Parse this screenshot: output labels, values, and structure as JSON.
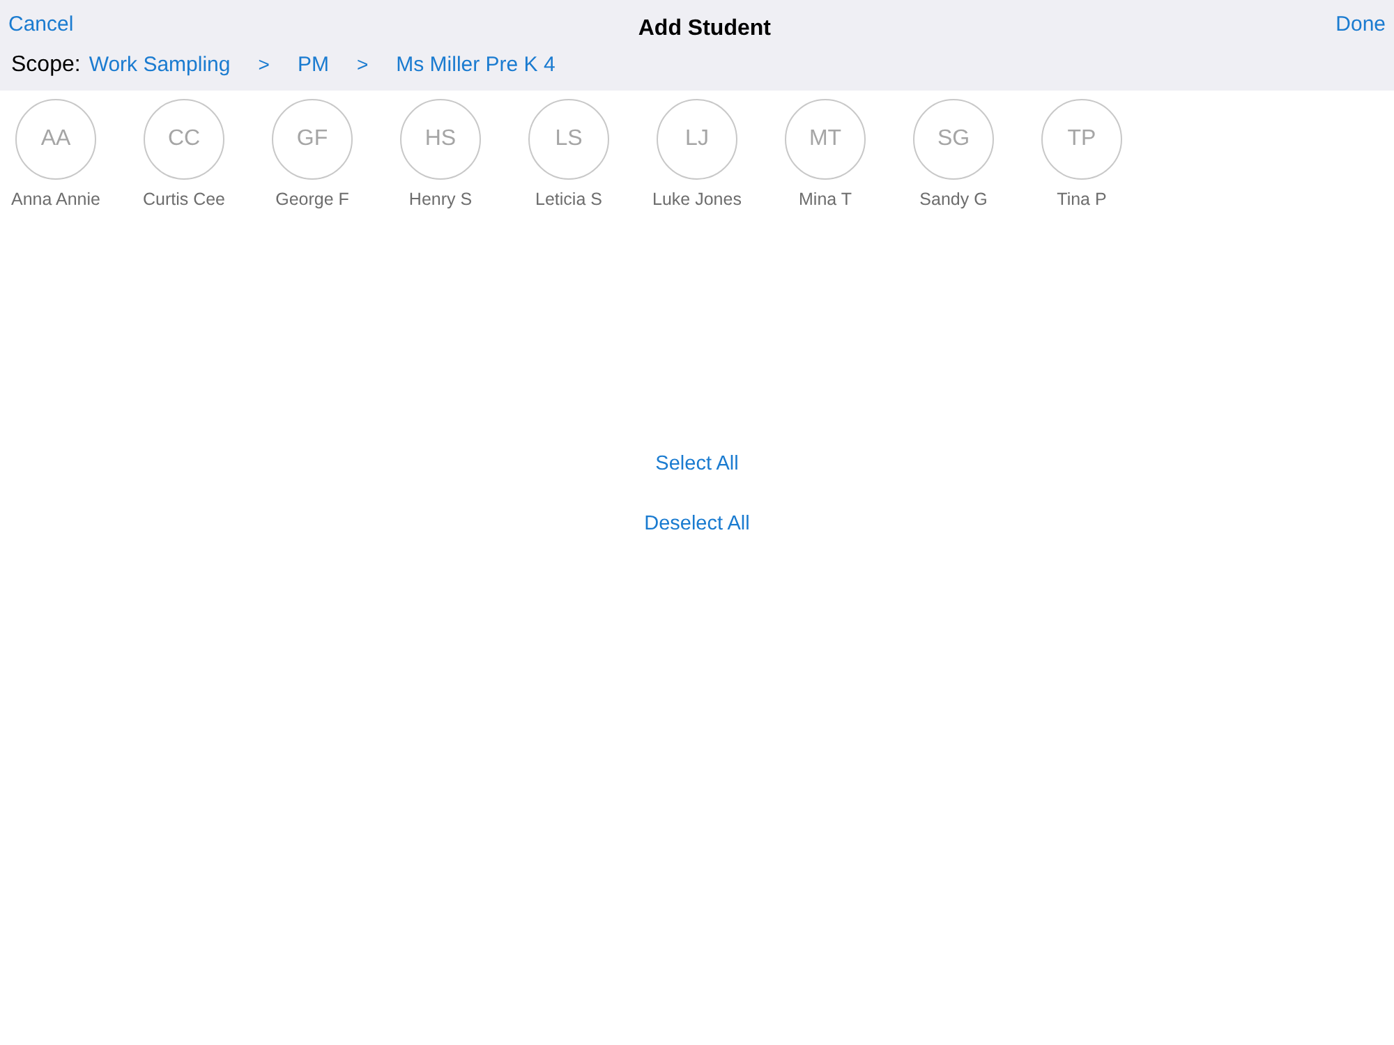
{
  "nav": {
    "cancel": "Cancel",
    "title": "Add Student",
    "done": "Done"
  },
  "scope": {
    "label": "Scope:",
    "crumbs": [
      "Work Sampling",
      "PM",
      "Ms Miller Pre K 4"
    ],
    "separator": ">"
  },
  "students": [
    {
      "initials": "AA",
      "name": "Anna Annie"
    },
    {
      "initials": "CC",
      "name": "Curtis Cee"
    },
    {
      "initials": "GF",
      "name": "George F"
    },
    {
      "initials": "HS",
      "name": "Henry S"
    },
    {
      "initials": "LS",
      "name": "Leticia S"
    },
    {
      "initials": "LJ",
      "name": "Luke Jones"
    },
    {
      "initials": "MT",
      "name": "Mina T"
    },
    {
      "initials": "SG",
      "name": "Sandy G"
    },
    {
      "initials": "TP",
      "name": "Tina P"
    }
  ],
  "actions": [
    "Select All",
    "Deselect All"
  ]
}
